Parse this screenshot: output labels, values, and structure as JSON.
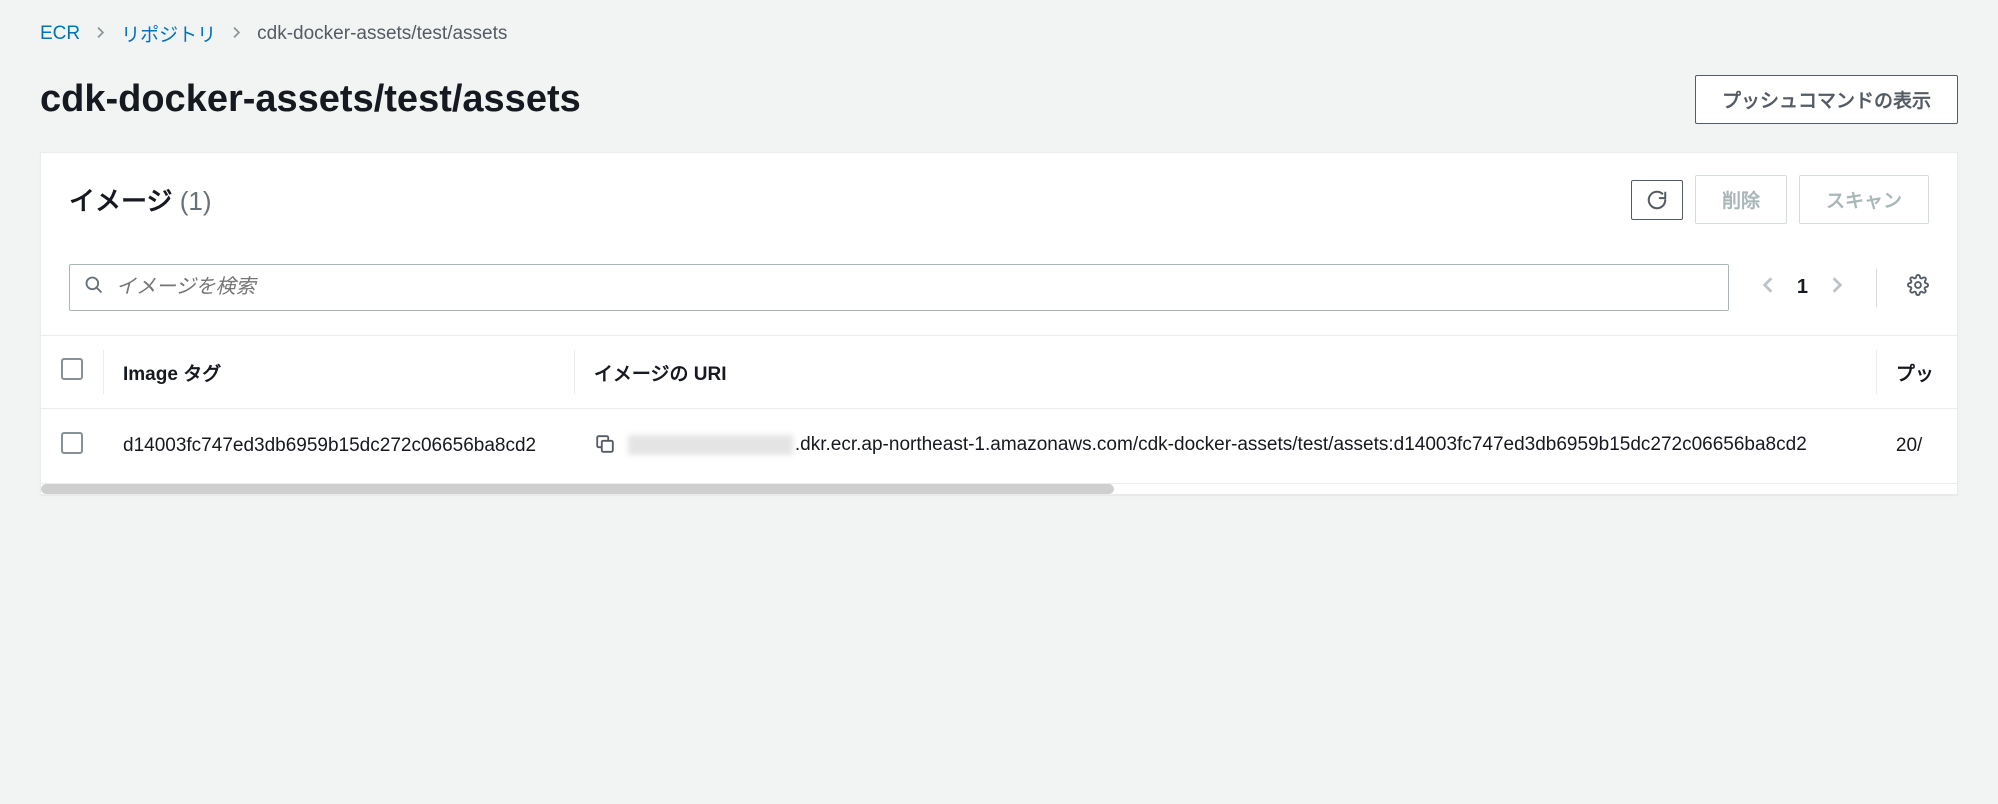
{
  "breadcrumb": {
    "root": "ECR",
    "repos": "リポジトリ",
    "current": "cdk-docker-assets/test/assets"
  },
  "header": {
    "title": "cdk-docker-assets/test/assets",
    "push_cmd_button": "プッシュコマンドの表示"
  },
  "panel": {
    "title": "イメージ",
    "count_label": "(1)",
    "delete_button": "削除",
    "scan_button": "スキャン"
  },
  "search": {
    "placeholder": "イメージを検索"
  },
  "pagination": {
    "page": "1"
  },
  "table": {
    "columns": {
      "tag": "Image タグ",
      "uri": "イメージの URI",
      "pushed": "プッ"
    },
    "rows": [
      {
        "tag": "d14003fc747ed3db6959b15dc272c06656ba8cd2",
        "uri_suffix": ".dkr.ecr.ap-northeast-1.amazonaws.com/cdk-docker-assets/test/assets:d14003fc747ed3db6959b15dc272c06656ba8cd2",
        "pushed": "20/"
      }
    ]
  }
}
